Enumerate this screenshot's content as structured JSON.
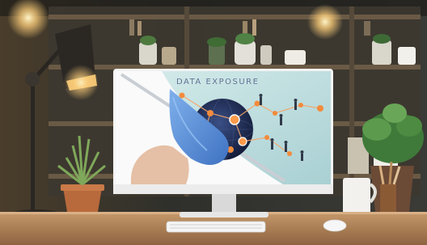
{
  "photo": {
    "screen_caption": "DATA EXPOSURE",
    "palette": {
      "wall_dark": "#2b2a25",
      "shelf_wood": "#5a4a38",
      "desk_wood": "#b4865a",
      "bezel": "#f1f1f1",
      "screen_teal": "#b9dadb",
      "network_node": "#f28b3c",
      "globe_blue": "#1f2c56",
      "glove_blue": "#5b8fd8",
      "lamp_glow": "#ffd58a"
    },
    "objects": [
      "desk-lamp",
      "potted-plant-left",
      "potted-plant-right",
      "computer-monitor",
      "keyboard",
      "mouse",
      "mug",
      "pencil-holder",
      "bookshelf"
    ]
  }
}
